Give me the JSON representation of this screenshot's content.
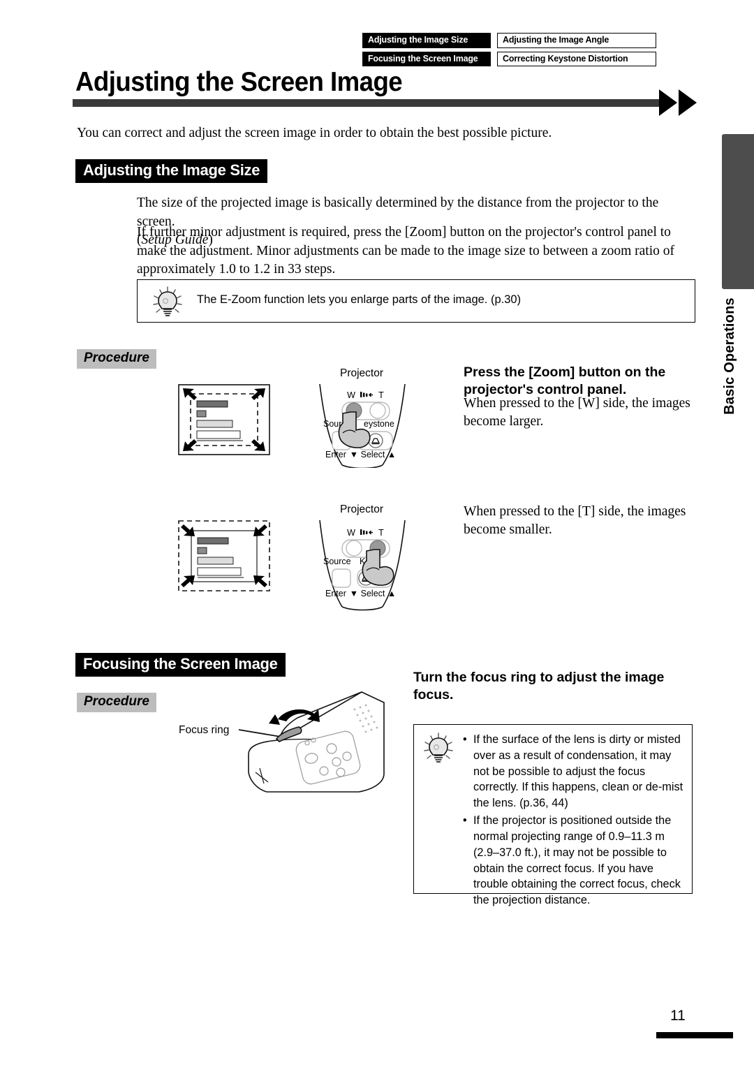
{
  "header": {
    "chips": [
      {
        "label": "Adjusting the Image Size",
        "active": true
      },
      {
        "label": "Adjusting the Image Angle",
        "active": false
      },
      {
        "label": "Focusing the Screen Image",
        "active": true
      },
      {
        "label": "Correcting Keystone Distortion",
        "active": false
      }
    ]
  },
  "title": "Adjusting the Screen Image",
  "intro": "You can correct and adjust the screen image in order to obtain the best possible picture.",
  "sections": {
    "image_size": {
      "heading": "Adjusting the Image Size",
      "paragraph_1_main": "The size of the projected image is basically determined by the distance from the projector to the screen.",
      "paragraph_1_ref_open": "(",
      "paragraph_1_ref": "Setup Guide",
      "paragraph_1_ref_close": ")",
      "paragraph_2": "If further minor adjustment is required, press the [Zoom] button on the projector's control panel to make the adjustment. Minor adjustments can be made to the image size to between a zoom ratio of approximately 1.0 to 1.2 in 33 steps.",
      "tip": "The E-Zoom function lets you enlarge parts of the image. (p.30)",
      "procedure_label": "Procedure",
      "step_heading": "Press the [Zoom] button on the projector's control panel.",
      "step_body_w": "When pressed to the [W] side, the images become larger.",
      "step_body_t": "When pressed to the [T] side, the images become smaller."
    },
    "focusing": {
      "heading": "Focusing the Screen Image",
      "procedure_label": "Procedure",
      "step_heading": "Turn the focus ring to adjust the image focus.",
      "tips": [
        "If the surface of the lens is dirty or misted over as a result of condensation, it may not be possible to adjust the focus correctly. If this happens, clean or de-mist the lens. (p.36, 44)",
        "If the projector is positioned outside the normal projecting range of 0.9–11.3 m (2.9–37.0 ft.), it may not be possible to obtain the correct focus. If you have trouble obtaining the correct focus, check the projection distance."
      ]
    }
  },
  "diagrams": {
    "panel_caption": "Projector",
    "panel_labels": {
      "w": "W",
      "t": "T",
      "source": "Source",
      "keystone": "Keystone",
      "keystone_clipped": "eystone",
      "keystone_clipped2": "Key",
      "enter": "Enter",
      "select": "▼ Select ▲"
    },
    "focus_ring_label": "Focus ring"
  },
  "sidebar": {
    "tab_label": "Basic Operations"
  },
  "footer": {
    "page_number": "11"
  },
  "colors": {
    "accent_bar": "#3a3a3a",
    "section_bar": "#000000",
    "procedure_bg": "#bdbdbd",
    "side_tab": "#4d4d4d"
  }
}
